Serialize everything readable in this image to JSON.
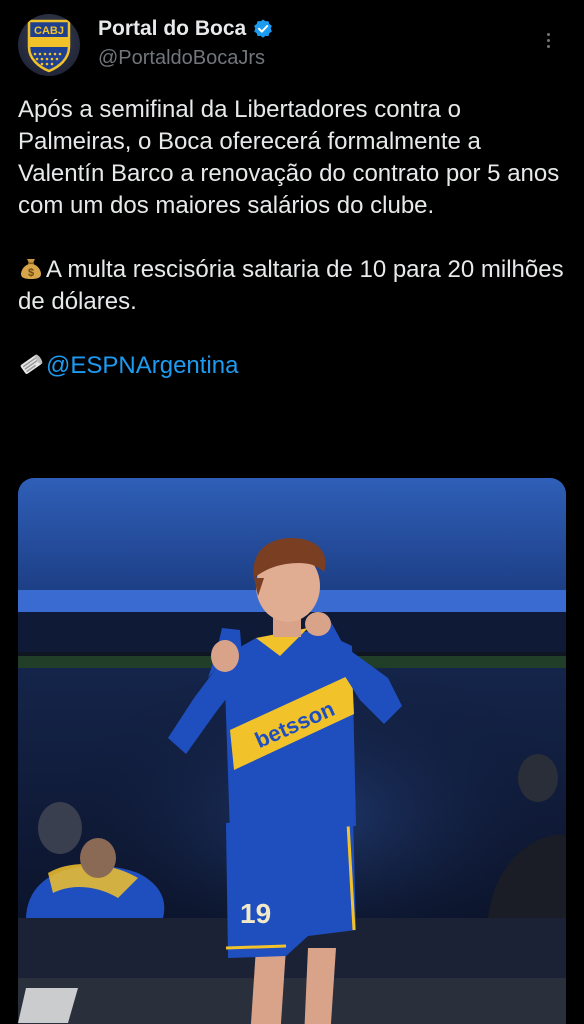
{
  "author": {
    "display_name": "Portal do Boca",
    "handle": "@PortaldoBocaJrs",
    "verified": true,
    "avatar_icon": "club-crest-icon",
    "avatar_text": "CABJ"
  },
  "tweet": {
    "paragraph_1": "Após a semifinal da Libertadores contra o Palmeiras, o Boca oferecerá formalmente a Valentín Barco a renovação do contrato por 5 anos com um dos maiores salários do clube.",
    "paragraph_2_emoji": "money-bag-icon",
    "paragraph_2": "A multa rescisória saltaria de 10 para 20 milhões de dólares.",
    "source_emoji": "newspaper-icon",
    "source_mention": "@ESPNArgentina"
  },
  "media": {
    "kind": "photo",
    "jersey_sponsor": "betsson",
    "jersey_number": "19"
  },
  "colors": {
    "background": "#000000",
    "text": "#e7e9ea",
    "secondary_text": "#71767b",
    "link": "#1d9bf0",
    "verified": "#1d9bf0",
    "boca_blue": "#1f4fbf",
    "boca_yellow": "#f2c22b"
  }
}
